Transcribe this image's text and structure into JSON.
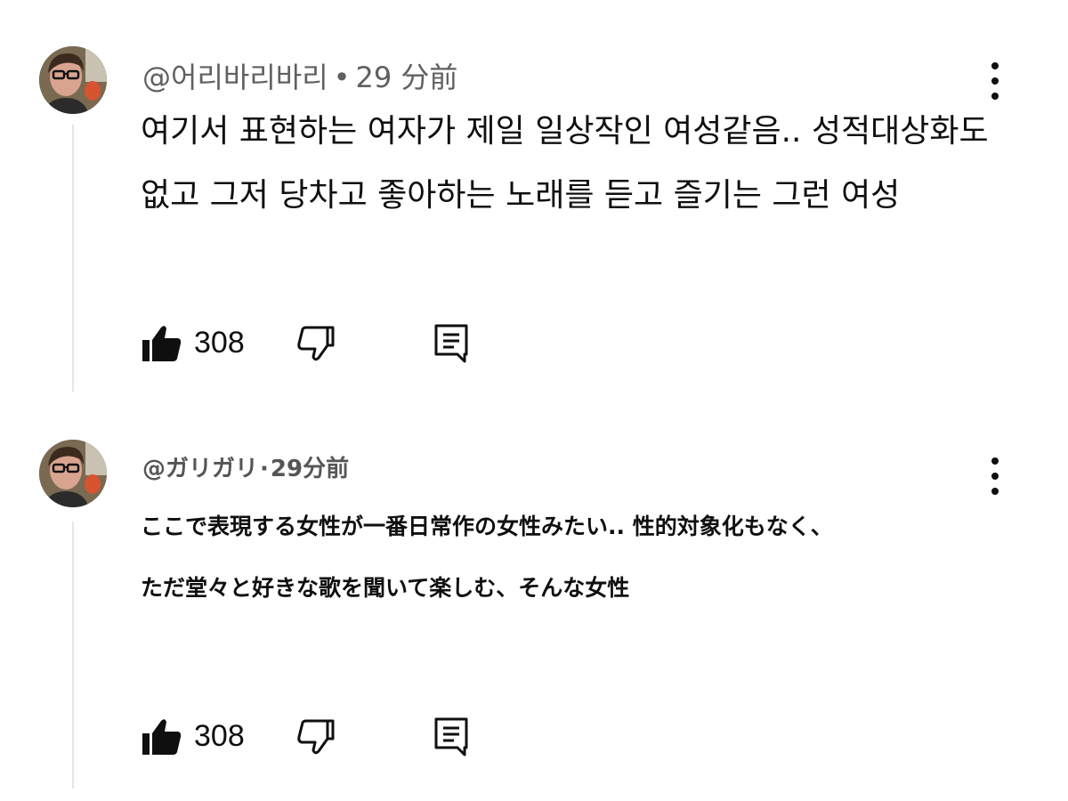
{
  "comments": [
    {
      "author": "@어리바리바리",
      "separator": "•",
      "time": "29 分前",
      "text": "여기서 표현하는 여자가 제일 일상작인 여성같음.. 성적대상화도 없고 그저 당차고 좋아하는 노래를 듣고 즐기는 그런 여성",
      "likes": "308"
    },
    {
      "author": "@ガリガリ",
      "separator": "·",
      "time": "29分前",
      "text_line1": "ここで表現する女性が一番日常作の女性みたい.. 性的対象化もなく、",
      "text_line2": "ただ堂々と好きな歌を聞いて楽しむ、そんな女性",
      "likes": "308"
    }
  ],
  "icons": {
    "like": "thumbs-up-icon",
    "dislike": "thumbs-down-icon",
    "reply": "reply-comment-icon",
    "more": "more-vertical-icon"
  },
  "colors": {
    "meta_text": "#606060",
    "body_text": "#0f0f0f",
    "thread_line": "#e5e5e5"
  }
}
